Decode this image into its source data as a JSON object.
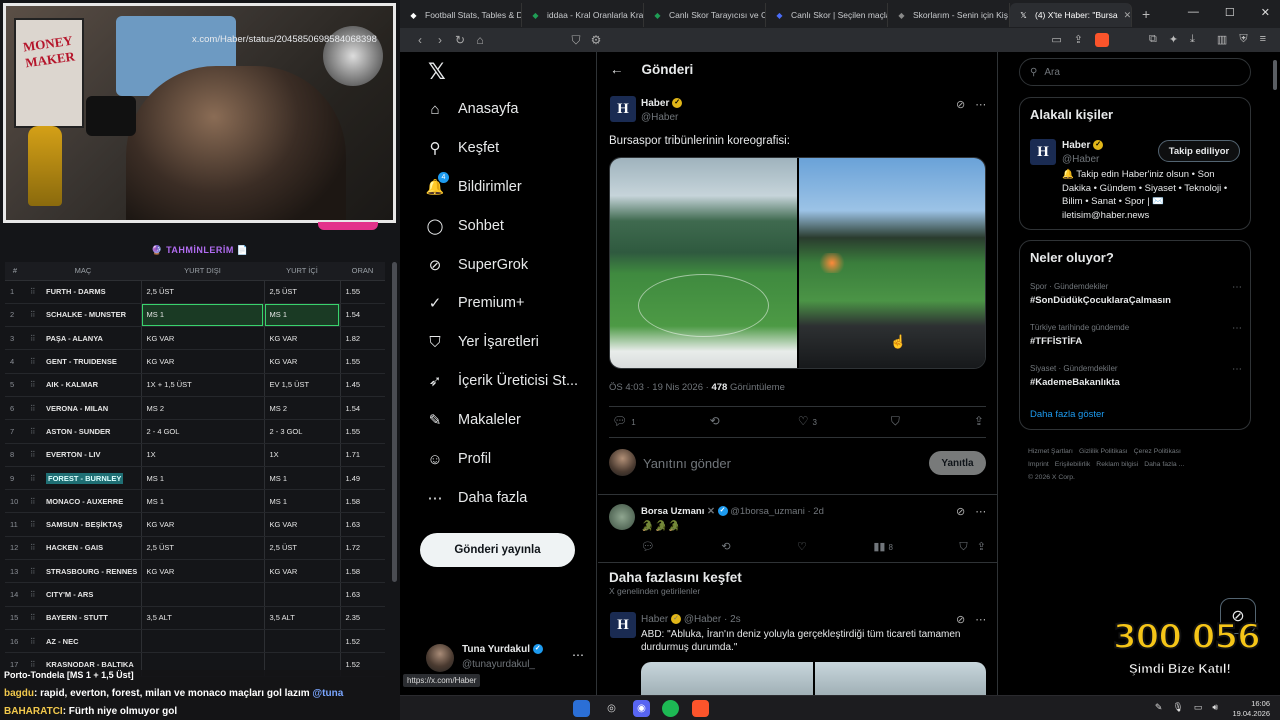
{
  "stream": {
    "poster_text": "MONEY MAKER",
    "predictions_title": "🔮 TAHMİNLERİM 📄",
    "table": {
      "headers": [
        "#",
        "MAÇ",
        "YURT DIŞI",
        "YURT İÇİ",
        "ORAN"
      ],
      "rows": [
        {
          "n": "1",
          "match": "FURTH - DARMS",
          "yd": "2,5 ÜST",
          "yi": "2,5 ÜST",
          "odd": "1.55"
        },
        {
          "n": "2",
          "match": "SCHALKE - MUNSTER",
          "yd": "MS 1",
          "yi": "MS 1",
          "odd": "1.54",
          "highlight": true
        },
        {
          "n": "3",
          "match": "PAŞA - ALANYA",
          "yd": "KG VAR",
          "yi": "KG VAR",
          "odd": "1.82"
        },
        {
          "n": "4",
          "match": "GENT - TRUIDENSE",
          "yd": "KG VAR",
          "yi": "KG VAR",
          "odd": "1.55"
        },
        {
          "n": "5",
          "match": "AIK - KALMAR",
          "yd": "1X + 1,5 ÜST",
          "yi": "EV 1,5 ÜST",
          "odd": "1.45"
        },
        {
          "n": "6",
          "match": "VERONA - MILAN",
          "yd": "MS 2",
          "yi": "MS 2",
          "odd": "1.54"
        },
        {
          "n": "7",
          "match": "ASTON - SUNDER",
          "yd": "2 - 4 GOL",
          "yi": "2 - 3 GOL",
          "odd": "1.55"
        },
        {
          "n": "8",
          "match": "EVERTON - LIV",
          "yd": "1X",
          "yi": "1X",
          "odd": "1.71"
        },
        {
          "n": "9",
          "match": "FOREST - BURNLEY",
          "yd": "MS 1",
          "yi": "MS 1",
          "odd": "1.49",
          "text_highlight": true
        },
        {
          "n": "10",
          "match": "MONACO - AUXERRE",
          "yd": "MS 1",
          "yi": "MS 1",
          "odd": "1.58"
        },
        {
          "n": "11",
          "match": "SAMSUN - BEŞİKTAŞ",
          "yd": "KG VAR",
          "yi": "KG VAR",
          "odd": "1.63"
        },
        {
          "n": "12",
          "match": "HACKEN - GAIS",
          "yd": "2,5 ÜST",
          "yi": "2,5 ÜST",
          "odd": "1.72"
        },
        {
          "n": "13",
          "match": "STRASBOURG - RENNES",
          "yd": "KG VAR",
          "yi": "KG VAR",
          "odd": "1.58"
        },
        {
          "n": "14",
          "match": "CITY'M - ARS",
          "yd": "",
          "yi": "",
          "odd": "1.63"
        },
        {
          "n": "15",
          "match": "BAYERN - STUTT",
          "yd": "3,5 ALT",
          "yi": "3,5 ALT",
          "odd": "2.35"
        },
        {
          "n": "16",
          "match": "AZ - NEC",
          "yd": "",
          "yi": "",
          "odd": "1.52"
        },
        {
          "n": "17",
          "match": "KRASNODAR - BALTIKA",
          "yd": "",
          "yi": "",
          "odd": "1.52"
        }
      ]
    },
    "chat": {
      "cut_line": "Porto-Tondela [MS 1 + 1,5 Üst]",
      "messages": [
        {
          "user": "bagdu",
          "text": ": rapid, everton, forest, milan ve monaco maçları gol lazım ",
          "mention": "@tuna"
        },
        {
          "user": "BAHARATCI",
          "text": ": Fürth niye olmuyor gol",
          "mention": ""
        }
      ]
    }
  },
  "browser": {
    "tabs": [
      {
        "label": "Football Stats, Tables & D",
        "icon": "football-icon",
        "color": "#ffffff"
      },
      {
        "label": "iddaa - Kral Oranlarla Kra",
        "icon": "iddaa-icon",
        "color": "#1f9d55"
      },
      {
        "label": "Canlı Skor Tarayıcısı ve Ca",
        "icon": "livescore-icon",
        "color": "#1f9d55"
      },
      {
        "label": "Canlı Skor | Seçilen maçla",
        "icon": "livescore-icon",
        "color": "#4a6cf7"
      },
      {
        "label": "Skorlarım - Senin için Kiş",
        "icon": "skor-icon",
        "color": "#888888"
      },
      {
        "label": "(4) X'te Haber: \"Bursa",
        "icon": "x-icon",
        "color": "#ffffff",
        "active": true
      }
    ],
    "url": "x.com/Haber/status/2045850698584068398",
    "status_url": "https://x.com/Haber"
  },
  "x": {
    "nav": [
      {
        "label": "Anasayfa",
        "icon": "home-icon",
        "glyph": "⌂"
      },
      {
        "label": "Keşfet",
        "icon": "search-icon",
        "glyph": "⚲"
      },
      {
        "label": "Bildirimler",
        "icon": "bell-icon",
        "glyph": "🔔",
        "badge": "4"
      },
      {
        "label": "Sohbet",
        "icon": "chat-icon",
        "glyph": "◯"
      },
      {
        "label": "SuperGrok",
        "icon": "grok-icon",
        "glyph": "⊘"
      },
      {
        "label": "Premium+",
        "icon": "premium-icon",
        "glyph": "✓"
      },
      {
        "label": "Yer İşaretleri",
        "icon": "bookmark-icon",
        "glyph": "⛉"
      },
      {
        "label": "İçerik Üreticisi St...",
        "icon": "rocket-icon",
        "glyph": "➶"
      },
      {
        "label": "Makaleler",
        "icon": "article-icon",
        "glyph": "✎"
      },
      {
        "label": "Profil",
        "icon": "profile-icon",
        "glyph": "☺"
      },
      {
        "label": "Daha fazla",
        "icon": "more-icon",
        "glyph": "⋯"
      }
    ],
    "post_button": "Gönderi yayınla",
    "account": {
      "name": "Tuna Yurdakul",
      "handle": "@tunayurdakul_"
    },
    "header_title": "Gönderi",
    "tweet": {
      "name": "Haber",
      "handle": "@Haber",
      "text": "Bursaspor tribünlerinin koreografisi:",
      "time": "ÖS 4:03 · 19 Nis 2026 · ",
      "views": "478",
      "views_label": " Görüntüleme",
      "replies": "1",
      "retweets": "",
      "likes": "3"
    },
    "reply_placeholder": "Yanıtını gönder",
    "reply_button": "Yanıtla",
    "reply1": {
      "name": "Borsa Uzmanı",
      "handle": "@1borsa_uzmani · 2d",
      "body": "🐊🐊🐊",
      "views": "8"
    },
    "discover_title": "Daha fazlasını keşfet",
    "discover_sub": "X genelinden getirilenler",
    "tweet2": {
      "name": "Haber",
      "handle": "@Haber · 2s",
      "text": "ABD: \"Abluka, İran'ın deniz yoluyla gerçekleştirdiği tüm ticareti tamamen durdurmuş durumda.\""
    },
    "search_placeholder": "Ara",
    "related": {
      "title": "Alakalı kişiler",
      "name": "Haber",
      "handle": "@Haber",
      "follow": "Takip ediliyor",
      "bio": "🔔 Takip edin Haber'iniz olsun • Son Dakika • Gündem • Siyaset • Teknoloji • Bilim • Sanat • Spor | ✉️ iletisim@haber.news"
    },
    "trends": {
      "title": "Neler oluyor?",
      "items": [
        {
          "context": "Spor · Gündemdekiler",
          "tag": "#SonDüdükÇocuklaraÇalmasın"
        },
        {
          "context": "Türkiye tarihinde gündemde",
          "tag": "#TFFİSTİFA"
        },
        {
          "context": "Siyaset · Gündemdekiler",
          "tag": "#KademeBakanlıkta"
        }
      ],
      "more": "Daha fazla göster"
    },
    "footer": [
      "Hizmet Şartları",
      "Gizlilik Politikası",
      "Çerez Politikası",
      "Imprint",
      "Erişilebilirlik",
      "Reklam bilgisi",
      "Daha fazla ...",
      "© 2026 X Corp."
    ]
  },
  "promo": {
    "count": "300 056",
    "sub": "Şimdi Bize Katıl!"
  },
  "taskbar": {
    "time": "16:06",
    "date": "19.04.2026"
  },
  "colors": {
    "accent": "#1d9bf0",
    "gold_verified": "#e2b719",
    "highlight_green": "#39d36d"
  }
}
